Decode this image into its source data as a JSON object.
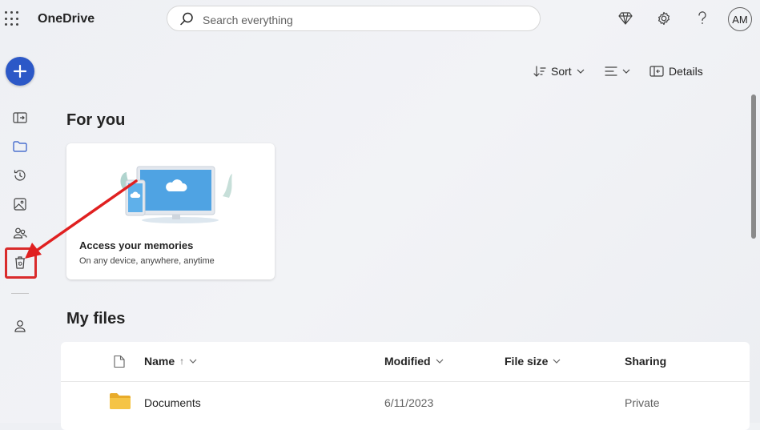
{
  "app": {
    "title": "OneDrive"
  },
  "search": {
    "placeholder": "Search everything"
  },
  "user": {
    "initials": "AM"
  },
  "toolbar": {
    "sort_label": "Sort",
    "details_label": "Details"
  },
  "sections": {
    "for_you": "For you",
    "my_files": "My files"
  },
  "card": {
    "title": "Access your memories",
    "subtitle": "On any device, anywhere, anytime"
  },
  "table": {
    "columns": [
      "Name",
      "Modified",
      "File size",
      "Sharing"
    ],
    "sort_indicator": "↑",
    "rows": [
      {
        "name": "Documents",
        "modified": "6/11/2023",
        "size": "",
        "sharing": "Private"
      }
    ]
  },
  "colors": {
    "accent": "#2c58c7",
    "highlight": "#d92b2b",
    "folder": "#f5c445"
  }
}
